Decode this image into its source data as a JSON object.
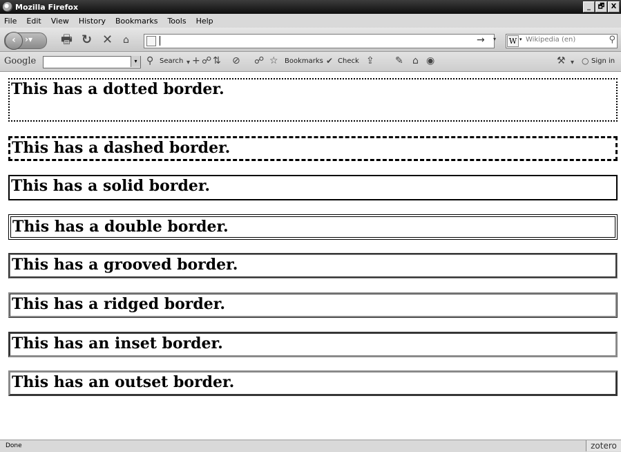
{
  "window": {
    "title": "Mozilla Firefox",
    "controls": [
      "_",
      "🗗",
      "X"
    ]
  },
  "menubar": {
    "items": [
      "File",
      "Edit",
      "View",
      "History",
      "Bookmarks",
      "Tools",
      "Help"
    ]
  },
  "navbar": {
    "url_value": "",
    "search_placeholder": "Wikipedia (en)",
    "search_engine_letter": "W"
  },
  "google_toolbar": {
    "logo": "Google",
    "search_label": "Search",
    "bookmarks_label": "Bookmarks",
    "check_label": "Check",
    "signin_label": "Sign in"
  },
  "content": {
    "boxes": [
      {
        "style": "dotted",
        "text": "This has a dotted border."
      },
      {
        "style": "dashed",
        "text": "This has a dashed border."
      },
      {
        "style": "solid",
        "text": "This has a solid border."
      },
      {
        "style": "double",
        "text": "This has a double border."
      },
      {
        "style": "groove",
        "text": "This has a grooved border."
      },
      {
        "style": "ridge",
        "text": "This has a ridged border."
      },
      {
        "style": "inset",
        "text": "This has an inset border."
      },
      {
        "style": "outset",
        "text": "This has an outset border."
      }
    ]
  },
  "statusbar": {
    "status": "Done",
    "addon": "zotero"
  }
}
